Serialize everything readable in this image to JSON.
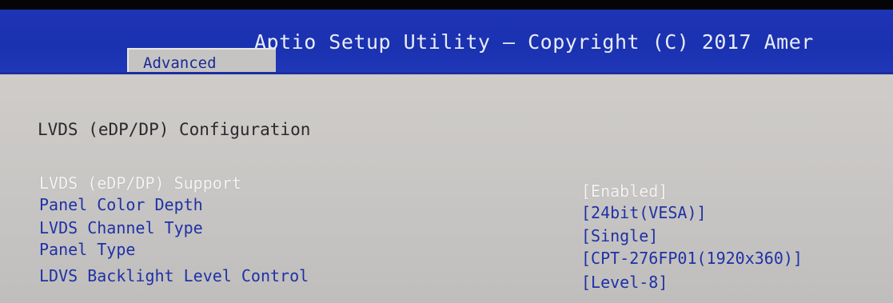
{
  "header": {
    "title": "Aptio Setup Utility – Copyright (C) 2017 Amer",
    "active_tab": "Advanced"
  },
  "page": {
    "heading": "LVDS (eDP/DP) Configuration"
  },
  "settings": [
    {
      "label": "LVDS (eDP/DP) Support",
      "value": "[Enabled]"
    },
    {
      "label": "Panel Color Depth",
      "value": "[24bit(VESA)]"
    },
    {
      "label": "LVDS Channel Type",
      "value": "[Single]"
    },
    {
      "label": "Panel Type",
      "value": "[CPT-276FP01(1920x360)]"
    },
    {
      "label": "LDVS Backlight Level Control",
      "value": "[Level-8]"
    }
  ],
  "colors": {
    "header_background": "#1e34b6",
    "content_background": "#c9c6c3",
    "selected_text": "#f4f4f2",
    "setting_text": "#1f31a6"
  }
}
